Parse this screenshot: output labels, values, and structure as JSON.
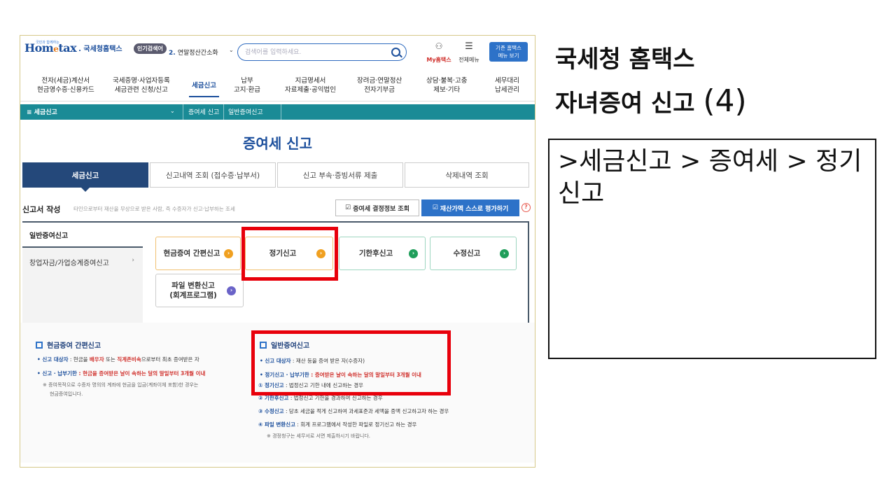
{
  "slide": {
    "title_line1": "국세청 홈택스",
    "title_line2": "자녀증여 신고",
    "title_num": "(4)",
    "path": ">세금신고 > 증여세 > 정기신고"
  },
  "header": {
    "logo_tagline": "국민과 함께하는",
    "logo_home": "Hom",
    "logo_e": "e",
    "logo_tax": "tax",
    "logo_nts": ". 국세청홈택스",
    "popular_label": "인기검색어",
    "popular_num": "2.",
    "popular_term": "연말정산간소화",
    "search_placeholder": "검색어를 입력하세요.",
    "myhome_label": "My홈택스",
    "allmenu_label": "전체메뉴",
    "oldhome_line1": "기존 홈택스",
    "oldhome_line2": "메뉴 보기"
  },
  "gnb": [
    {
      "line1": "전자(세금)계산서",
      "line2": "현금영수증·신용카드"
    },
    {
      "line1": "국세증명·사업자등록",
      "line2": "세금관련 신청/신고"
    },
    {
      "line1": "세금신고",
      "line2": ""
    },
    {
      "line1": "납부",
      "line2": "고지·환급"
    },
    {
      "line1": "지급명세서",
      "line2": "자료제출·공익법인"
    },
    {
      "line1": "장려금·연말정산",
      "line2": "전자기부금"
    },
    {
      "line1": "상담·불복·고충",
      "line2": "제보·기타"
    },
    {
      "line1": "세무대리",
      "line2": "납세관리"
    }
  ],
  "breadcrumb": {
    "menu": "≡  세금신고",
    "item1": "증여세 신고",
    "item2": "일반증여신고"
  },
  "page_title": "증여세 신고",
  "tabs": [
    "세금신고",
    "신고내역 조회 (접수증·납부서)",
    "신고 부속·증빙서류 제출",
    "삭제내역 조회"
  ],
  "form": {
    "heading": "신고서 작성",
    "description": "타인으로부터 재산을 무상으로 받은 사람, 즉 수증자가 신고·납부하는 조세",
    "btn_decision": "증여세 결정정보 조회",
    "btn_selfvalue": "재산가액 스스로 평가하기"
  },
  "side_menu": [
    "일반증여신고",
    "창업자금/가업승계증여신고"
  ],
  "options": [
    "현금증여 간편신고",
    "정기신고",
    "기한후신고",
    "수정신고",
    "파일 변환신고",
    "(회계프로그램)"
  ],
  "info_left": {
    "title": "현금증여 간편신고",
    "l1_label": "• 신고 대상자",
    "l1_a": " : 현금을 ",
    "l1_red1": "배우자",
    "l1_b": " 또는 ",
    "l1_red2": "직계존비속",
    "l1_c": "으로부터 최초 증여받은 자",
    "l2_label": "• 신고 · 납부기한",
    "l2_red": " : 현금을 증여받은 날이 속하는 달의 말일부터 3개월 이내",
    "note1": "※ 증여목적으로 수증자 명의의 계좌에 현금을 입금(계좌이체 포함)한 경우는",
    "note2": "현금증여입니다."
  },
  "info_right": {
    "title": "일반증여신고",
    "l1_label": "• 신고 대상자",
    "l1_text": " : 재산 등을 증여 받은 자(수증자)",
    "l2_label": "• 정기신고 · 납부기한",
    "l2_red": " : 증여받은 날이 속하는 달의 말일부터 3개월 이내",
    "i1_label": "① 정기신고",
    "i1_text": " : 법정신고 기한 내에 신고하는 경우",
    "i2_label": "② 기한후신고",
    "i2_text": " : 법정신고 기한을 경과하여 신고하는 경우",
    "i3_label": "③ 수정신고",
    "i3_text": " : 당초 세금을 적게 신고하여 과세표준과 세액을 증액 신고하고자 하는 경우",
    "i4_label": "④ 파일 변환신고",
    "i4_text": " : 회계 프로그램에서 작성한 파일로 정기신고 하는 경우",
    "note": "※ 경정청구는 세무서로 서면 제출하시기 바랍니다."
  },
  "colors": {
    "accent_blue": "#1c4f9c",
    "teal": "#1a8b96",
    "highlight_red": "#e8000b",
    "orange_icon": "#f0a020",
    "green_icon": "#1f9e5a",
    "purple_icon": "#6a63c8"
  }
}
